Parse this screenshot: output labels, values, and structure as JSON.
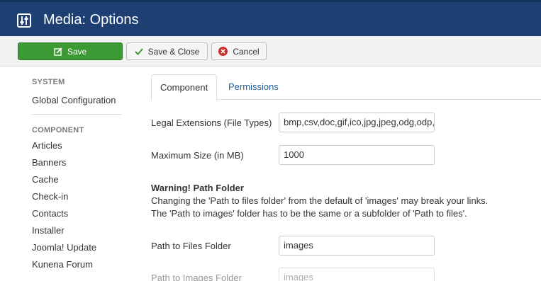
{
  "header": {
    "title": "Media: Options",
    "logo_icon": "settings-sliders-icon"
  },
  "toolbar": {
    "save_label": "Save",
    "save_close_label": "Save & Close",
    "cancel_label": "Cancel",
    "save_color": "#3b9a33"
  },
  "sidebar": {
    "system_heading": "SYSTEM",
    "system_items": [
      "Global Configuration"
    ],
    "component_heading": "COMPONENT",
    "component_items": [
      "Articles",
      "Banners",
      "Cache",
      "Check-in",
      "Contacts",
      "Installer",
      "Joomla! Update",
      "Kunena Forum"
    ]
  },
  "tabs": {
    "component": "Component",
    "permissions": "Permissions"
  },
  "form": {
    "legal_ext_label": "Legal Extensions (File Types)",
    "legal_ext_value": "bmp,csv,doc,gif,ico,jpg,jpeg,odg,odp,ods,odt,pdf,png,ppt,swf,txt,xcf,xls",
    "max_size_label": "Maximum Size (in MB)",
    "max_size_value": "1000",
    "warning_title": "Warning! Path Folder",
    "warning_line1": "Changing the 'Path to files folder' from the default of 'images' may break your links.",
    "warning_line2": "The 'Path to images' folder has to be the same or a subfolder of 'Path to files'.",
    "files_folder_label": "Path to Files Folder",
    "files_folder_value": "images",
    "images_folder_label": "Path to Images Folder",
    "images_folder_value": "images"
  }
}
